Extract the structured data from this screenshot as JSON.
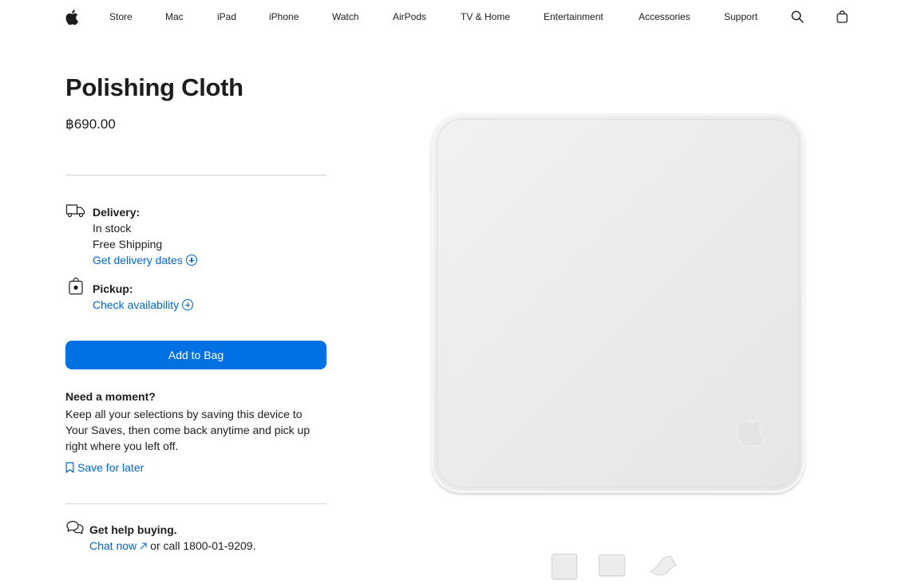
{
  "nav": {
    "items": [
      "Store",
      "Mac",
      "iPad",
      "iPhone",
      "Watch",
      "AirPods",
      "TV & Home",
      "Entertainment",
      "Accessories",
      "Support"
    ],
    "icons": [
      "apple-logo-icon",
      "search-icon",
      "bag-icon"
    ]
  },
  "product": {
    "title": "Polishing Cloth",
    "price": "฿690.00"
  },
  "delivery": {
    "label": "Delivery:",
    "status": "In stock",
    "shipping": "Free Shipping",
    "link": "Get delivery dates"
  },
  "pickup": {
    "label": "Pickup:",
    "link": "Check availability"
  },
  "add_to_bag": "Add to Bag",
  "moment": {
    "title": "Need a moment?",
    "text": "Keep all your selections by saving this device to Your Saves, then come back anytime and pick up right where you left off.",
    "save_link": "Save for later"
  },
  "help": {
    "title": "Get help buying.",
    "chat": "Chat now",
    "rest": "or call 1800-01-9209."
  },
  "colors": {
    "link": "#0066cc",
    "button": "#0071e3",
    "text": "#1d1d1f"
  }
}
